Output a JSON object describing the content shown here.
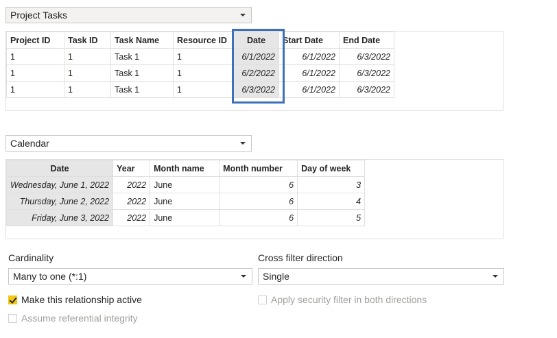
{
  "table1": {
    "selector": "Project Tasks",
    "columns": [
      "Project ID",
      "Task ID",
      "Task Name",
      "Resource ID",
      "Date",
      "Start Date",
      "End Date"
    ],
    "rows": [
      [
        "1",
        "1",
        "Task 1",
        "1",
        "6/1/2022",
        "6/1/2022",
        "6/3/2022"
      ],
      [
        "1",
        "1",
        "Task 1",
        "1",
        "6/2/2022",
        "6/1/2022",
        "6/3/2022"
      ],
      [
        "1",
        "1",
        "Task 1",
        "1",
        "6/3/2022",
        "6/1/2022",
        "6/3/2022"
      ]
    ]
  },
  "table2": {
    "selector": "Calendar",
    "columns": [
      "Date",
      "Year",
      "Month name",
      "Month number",
      "Day of week"
    ],
    "rows": [
      [
        "Wednesday, June 1, 2022",
        "2022",
        "June",
        "6",
        "3"
      ],
      [
        "Thursday, June 2, 2022",
        "2022",
        "June",
        "6",
        "4"
      ],
      [
        "Friday, June 3, 2022",
        "2022",
        "June",
        "6",
        "5"
      ]
    ]
  },
  "cardinality": {
    "label": "Cardinality",
    "value": "Many to one (*:1)"
  },
  "cross_filter": {
    "label": "Cross filter direction",
    "value": "Single"
  },
  "options": {
    "active": {
      "label": "Make this relationship active",
      "checked": true
    },
    "security": {
      "label": "Apply security filter in both directions",
      "checked": false
    },
    "integrity": {
      "label": "Assume referential integrity",
      "checked": false
    }
  },
  "colors": {
    "highlight": "#3e6fb9",
    "checkbox_on": "#f2c811"
  }
}
